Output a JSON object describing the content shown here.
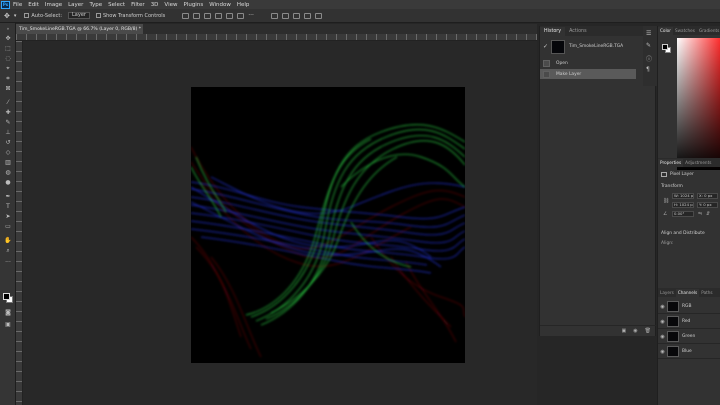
{
  "menu": {
    "logo": "Ps",
    "items": [
      "File",
      "Edit",
      "Image",
      "Layer",
      "Type",
      "Select",
      "Filter",
      "3D",
      "View",
      "Plugins",
      "Window",
      "Help"
    ]
  },
  "options": {
    "auto_select_label": "Auto-Select:",
    "auto_select_value": "Layer",
    "transform_label": "Show Transform Controls"
  },
  "document": {
    "tab_title": "Tim_SmokeLineRGB.TGA @ 66.7% (Layer 0, RGB/8) *",
    "close_glyph": "×"
  },
  "history": {
    "tabs": [
      "History",
      "Actions"
    ],
    "snapshot_name": "Tim_SmokeLineRGB.TGA",
    "states": [
      "Open",
      "Make Layer"
    ],
    "selected_state": "Make Layer"
  },
  "color_panel": {
    "tabs": [
      "Color",
      "Swatches",
      "Gradients"
    ],
    "foreground": "#000000",
    "background": "#ffffff"
  },
  "properties": {
    "tabs": [
      "Properties",
      "Adjustments"
    ],
    "layer_type": "Pixel Layer",
    "transform_heading": "Transform",
    "w_value": "W: 1024 px",
    "h_value": "H: 1024 px",
    "x_value": "X: 0 px",
    "y_value": "Y: 0 px",
    "angle_value": "0.00°",
    "align_heading": "Align and Distribute",
    "align_label": "Align:"
  },
  "channels": {
    "tabs": [
      "Layers",
      "Channels",
      "Paths"
    ],
    "items": [
      "RGB",
      "Red",
      "Green",
      "Blue"
    ]
  }
}
